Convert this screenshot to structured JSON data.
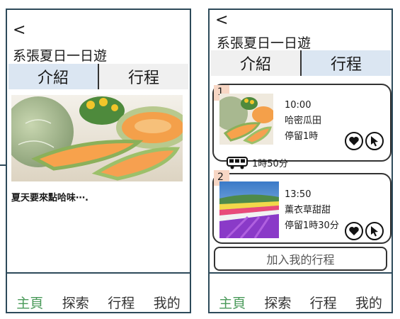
{
  "left": {
    "back": "<",
    "title": "系張夏日一日遊",
    "tabs": [
      "介紹",
      "行程"
    ],
    "description": "夏天要來點哈味⋯.",
    "nav": [
      "主頁",
      "探索",
      "行程",
      "我的"
    ]
  },
  "right": {
    "back": "<",
    "title": "系張夏日一日遊",
    "tabs": [
      "介紹",
      "行程"
    ],
    "stops": [
      {
        "num": "1",
        "time": "10:00",
        "place": "哈密瓜田",
        "stay": "停留1時"
      },
      {
        "num": "2",
        "time": "13:50",
        "place": "薰衣草甜甜",
        "stay": "停留1時30分"
      }
    ],
    "transit": "1時50分",
    "add_button": "加入我的行程",
    "nav": [
      "主頁",
      "探索",
      "行程",
      "我的"
    ]
  },
  "colors": {
    "accent_green": "#4a9a5a",
    "tab_active": "#dbe6f2",
    "frame": "#2d4a5a",
    "num_badge": "#f7d6c4"
  }
}
